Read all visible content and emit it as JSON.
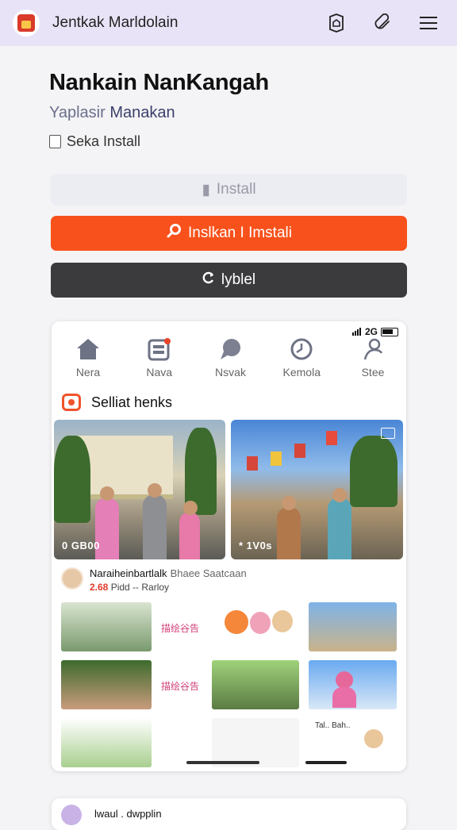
{
  "topbar": {
    "title": "Jentkak Marldolain",
    "icons": [
      "house-badge-icon",
      "paperclip-icon",
      "menu-icon"
    ]
  },
  "header": {
    "title": "Nankain NanKangah",
    "subtitle_prefix": "Yaplasir",
    "subtitle_rest": " Manakan",
    "checkbox_label": "Seka Install"
  },
  "buttons": {
    "light": "Install",
    "primary": "Inslkan I Imstali",
    "dark": "lyblel"
  },
  "colors": {
    "accent": "#f8511b",
    "dark_button": "#3b3b3d",
    "topbar": "#e9e3f7"
  },
  "phone": {
    "status_text": "2G",
    "nav": [
      {
        "label": "Nera",
        "icon": "home-icon"
      },
      {
        "label": "Nava",
        "icon": "gallery-icon"
      },
      {
        "label": "Nsvak",
        "icon": "chat-bubble-icon"
      },
      {
        "label": "Kemola",
        "icon": "clock-icon"
      },
      {
        "label": "Stee",
        "icon": "person-icon"
      }
    ],
    "section_title": "Selliat henks",
    "media": [
      {
        "caption": "0 GB00"
      },
      {
        "caption": "* 1V0s"
      }
    ],
    "post": {
      "name": "Naraiheinbartlalk",
      "name_extra": "Bhaee Saatcaan",
      "meta_count": "2.68",
      "meta_rest": " Pidd -- Rarloy"
    },
    "grid_labels": [
      "描绘谷告",
      "描绘谷告"
    ],
    "grid_row3_label": "Tal.. Bah.."
  },
  "bottom_card": {
    "title": "lwaul . dwpplin"
  }
}
